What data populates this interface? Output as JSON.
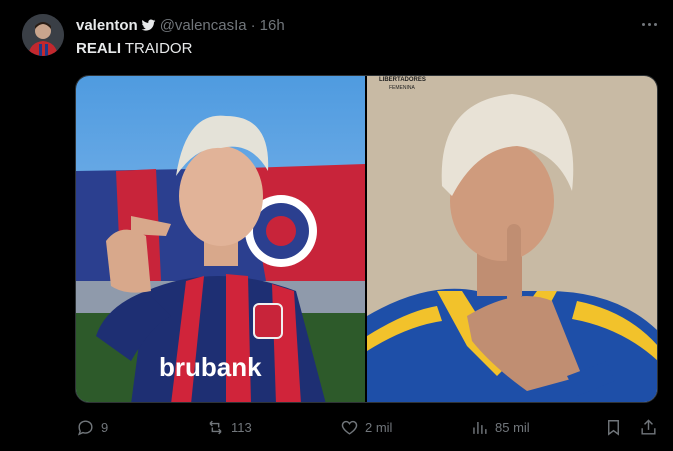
{
  "tweet": {
    "display_name": "valenton",
    "handle": "@valencasIa",
    "separator": "·",
    "time": "16h",
    "text_bold": "REALI",
    "text_rest": " TRAIDOR",
    "verified_icon": "bird-icon"
  },
  "media": {
    "left_photo": {
      "jersey_text": "brubank"
    },
    "right_photo": {
      "tag_line1": "LIBERTADORES",
      "tag_line2": "FEMENINA"
    }
  },
  "actions": {
    "replies": "9",
    "retweets": "113",
    "likes": "2 mil",
    "views": "85 mil"
  },
  "colors": {
    "background": "#000000",
    "text": "#e7e9ea",
    "muted": "#71767b"
  }
}
